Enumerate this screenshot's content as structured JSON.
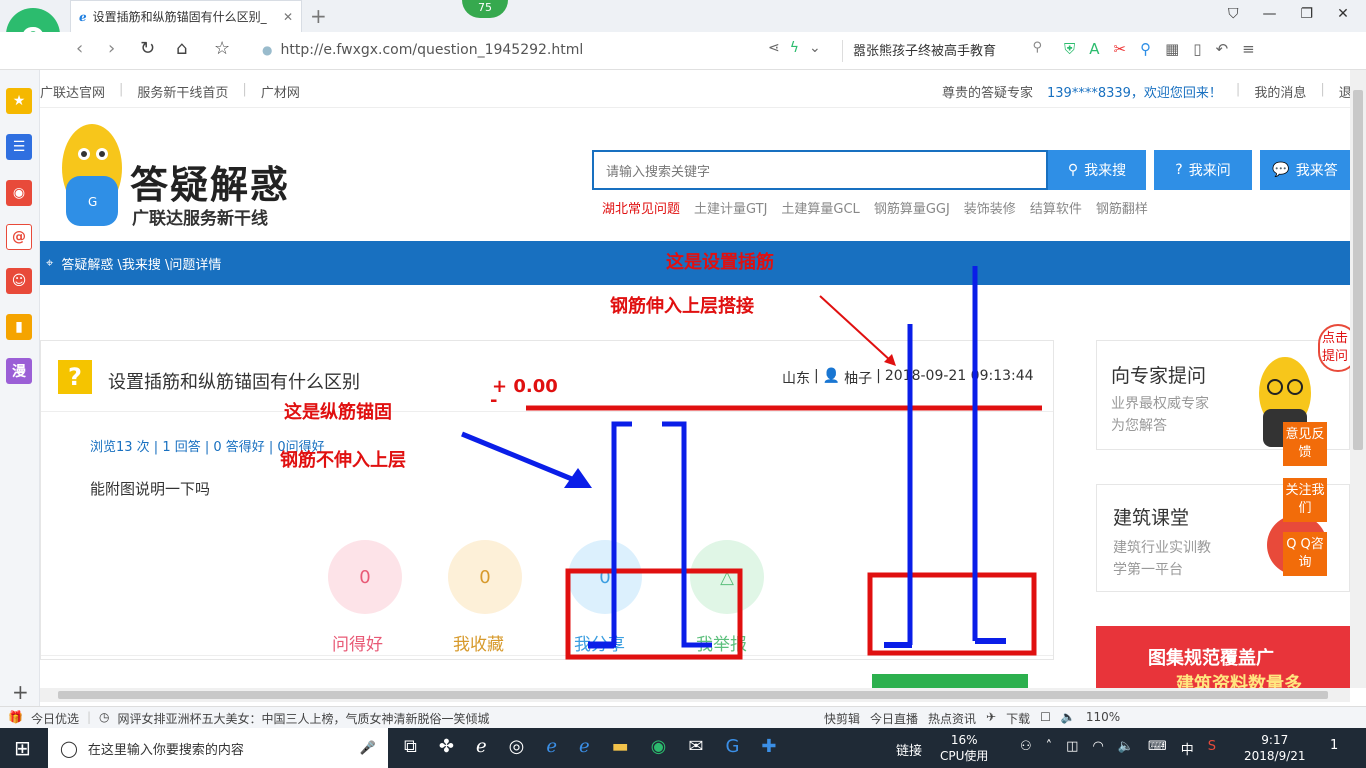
{
  "browser": {
    "tab_title": "设置插筋和纵筋锚固有什么区别_",
    "url": "http://e.fwxgx.com/question_1945292.html",
    "badge": "75",
    "headline_search": "嚣张熊孩子终被高手教育",
    "new_tab_symbol": "+"
  },
  "sidebar": {
    "add_symbol": "+",
    "manhua_label": "漫"
  },
  "toplinks": {
    "items": [
      "广联达官网",
      "服务新干线首页",
      "广材网"
    ],
    "expert": "尊贵的答疑专家",
    "welcome": "139****8339，欢迎您回来！",
    "messages": "我的消息",
    "logout": "退"
  },
  "logo": {
    "title": "答疑解惑",
    "subtitle": "广联达服务新干线"
  },
  "search": {
    "placeholder": "请输入搜索关键字",
    "btn_search": "我来搜",
    "btn_ask": "我来问",
    "btn_answer": "我来答",
    "hotwords": [
      "湖北常见问题",
      "土建计量GTJ",
      "土建算量GCL",
      "钢筋算量GGJ",
      "装饰装修",
      "结算软件",
      "钢筋翻样"
    ]
  },
  "breadcrumb": "答疑解惑 \\我来搜 \\问题详情",
  "question": {
    "title": "设置插筋和纵筋锚固有什么区别",
    "meta_location": "山东",
    "meta_user": "柚子",
    "meta_time": "2018-09-21 09:13:44",
    "stats": "浏览13 次 | 1 回答 | 0 答得好 | 0问得好",
    "body": "能附图说明一下吗",
    "actions": [
      {
        "count": "0",
        "label": "问得好"
      },
      {
        "count": "0",
        "label": "我收藏"
      },
      {
        "count": "0",
        "label": "我分享"
      },
      {
        "count": "",
        "label": "我举报"
      }
    ]
  },
  "annotations": {
    "elevation": "+ 0.00",
    "elevation_minus": "-",
    "setting_dowel": "这是设置插筋",
    "extend_lap": "钢筋伸入上层搭接",
    "longitudinal_anchor": "这是纵筋锚固",
    "not_extend": "钢筋不伸入上层"
  },
  "right": {
    "ask_expert_title": "向专家提问",
    "ask_expert_desc1": "业界最权威专家",
    "ask_expert_desc2": "为您解答",
    "click_hint": "点击提问",
    "course_title": "建筑课堂",
    "course_desc1": "建筑行业实训教",
    "course_desc2": "学第一平台",
    "feedback": "意见反馈",
    "follow": "关注我们",
    "qq": "Q Q咨询",
    "promo1": "图集规范覆盖广",
    "promo2": "建筑资料数量多"
  },
  "statusbar": {
    "today": "今日优选",
    "news": "网评女排亚洲杯五大美女：中国三人上榜，气质女神清新脱俗一笑倾城",
    "kuaiji": "快剪辑",
    "live": "今日直播",
    "hot": "热点资讯",
    "download": "下载",
    "zoom": "110%"
  },
  "taskbar": {
    "search_placeholder": "在这里输入你要搜索的内容",
    "link": "链接",
    "cpu_pct": "16%",
    "cpu_label": "CPU使用",
    "ime": "中",
    "time": "9:17",
    "date": "2018/9/21",
    "notif": "1"
  },
  "colors": {
    "brand_blue": "#1870c0",
    "annotation_red": "#e01010",
    "annotation_blue": "#0a1ee8",
    "orange": "#f26c0a"
  }
}
